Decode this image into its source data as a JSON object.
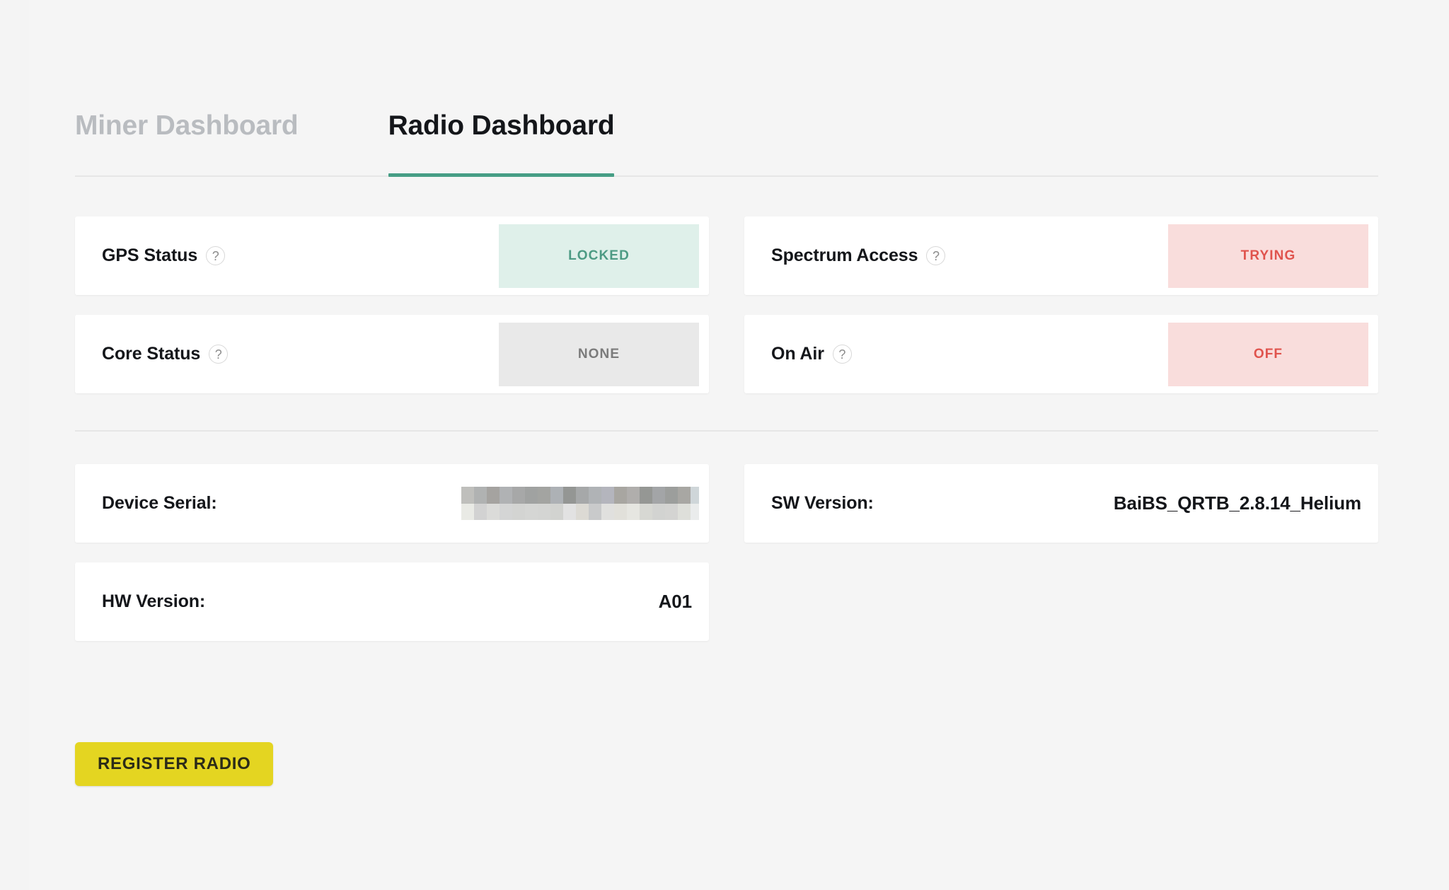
{
  "tabs": [
    {
      "label": "Miner Dashboard",
      "active": false
    },
    {
      "label": "Radio Dashboard",
      "active": true
    }
  ],
  "status_cards": [
    {
      "label": "GPS Status",
      "help": "?",
      "value": "LOCKED",
      "state": "locked"
    },
    {
      "label": "Spectrum Access",
      "help": "?",
      "value": "TRYING",
      "state": "trying"
    },
    {
      "label": "Core Status",
      "help": "?",
      "value": "NONE",
      "state": "none"
    },
    {
      "label": "On Air",
      "help": "?",
      "value": "OFF",
      "state": "off"
    }
  ],
  "info_cards": [
    {
      "label": "Device Serial:",
      "value": "",
      "redacted": true
    },
    {
      "label": "SW Version:",
      "value": "BaiBS_QRTB_2.8.14_Helium",
      "redacted": false
    },
    {
      "label": "HW Version:",
      "value": "A01",
      "redacted": false
    }
  ],
  "actions": {
    "register_radio": "REGISTER RADIO"
  },
  "colors": {
    "page_background": "#f4f4f4",
    "card_background": "#ffffff",
    "accent_tab_underline": "#469e85",
    "locked_bg": "#dff0ea",
    "locked_text": "#4d9b84",
    "trying_bg": "#f9dddc",
    "trying_text": "#e0534d",
    "none_bg": "#e9e9e9",
    "none_text": "#7b7b7b",
    "register_button_bg": "#e4d521",
    "register_button_text": "#2b2b18",
    "tab_inactive_text": "#b9bcc0",
    "tab_active_text": "#14161a"
  }
}
